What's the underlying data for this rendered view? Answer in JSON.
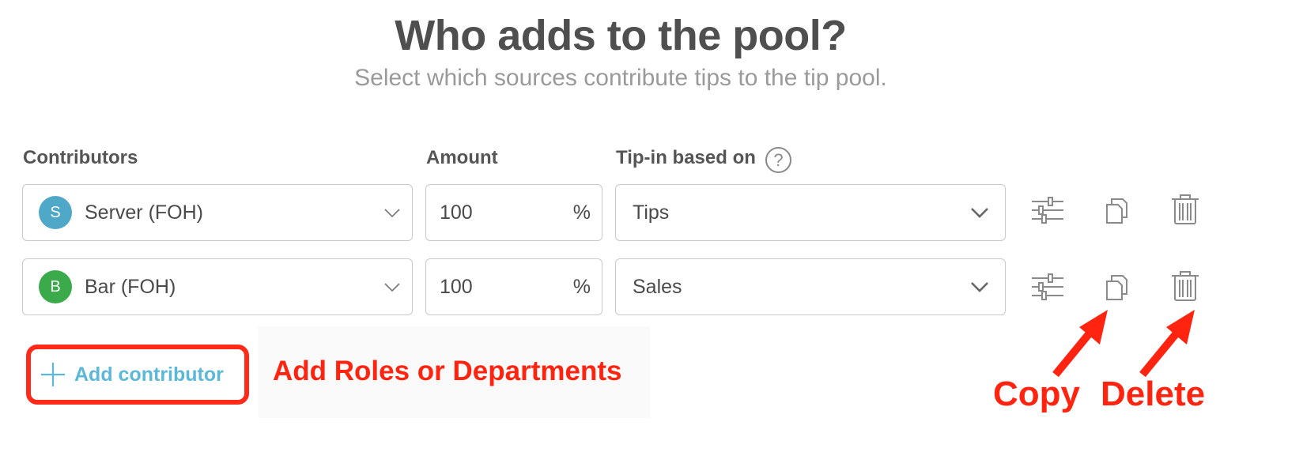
{
  "header": {
    "title": "Who adds to the pool?",
    "subtitle": "Select which sources contribute tips to the tip pool."
  },
  "columns": {
    "contributors": "Contributors",
    "amount": "Amount",
    "tip_in": "Tip-in based on",
    "help": "?"
  },
  "rows": [
    {
      "avatar_letter": "S",
      "avatar_color": "#4fa8c8",
      "contributor": "Server (FOH)",
      "amount": "100",
      "unit": "%",
      "based_on": "Tips"
    },
    {
      "avatar_letter": "B",
      "avatar_color": "#3aaa4a",
      "contributor": "Bar (FOH)",
      "amount": "100",
      "unit": "%",
      "based_on": "Sales"
    }
  ],
  "row_icons": [
    "sliders-icon",
    "copy-icon",
    "trash-icon"
  ],
  "add_button": {
    "label": "Add contributor",
    "icon": "plus-icon"
  },
  "annotations": {
    "add_note": "Add Roles or Departments",
    "copy": "Copy",
    "delete": "Delete"
  },
  "colors": {
    "accent": "#5cb8d8",
    "annotation": "#ff2410",
    "border": "#c9c9c9"
  }
}
